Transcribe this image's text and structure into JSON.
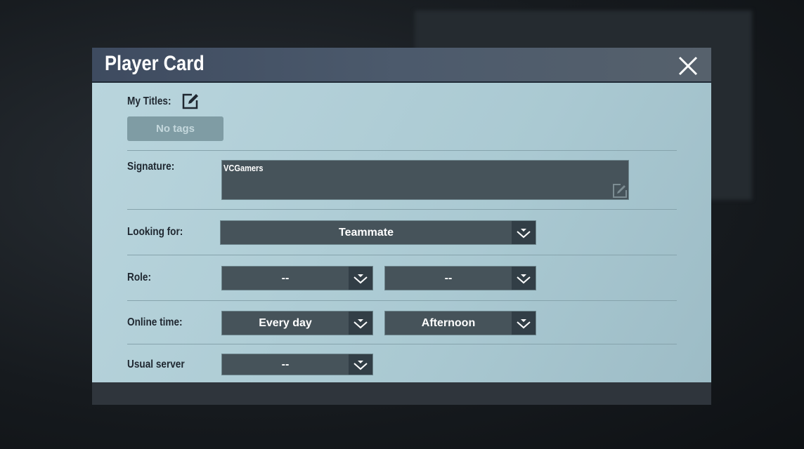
{
  "dialog": {
    "title": "Player Card"
  },
  "titles": {
    "label": "My Titles:",
    "no_tags": "No tags"
  },
  "signature": {
    "label": "Signature:",
    "value": "VCGamers"
  },
  "looking_for": {
    "label": "Looking for:",
    "value": "Teammate"
  },
  "role": {
    "label": "Role:",
    "value1": "--",
    "value2": "--"
  },
  "online_time": {
    "label": "Online time:",
    "days": "Every day",
    "period": "Afternoon"
  },
  "usual_server": {
    "label": "Usual server",
    "value": "--"
  }
}
